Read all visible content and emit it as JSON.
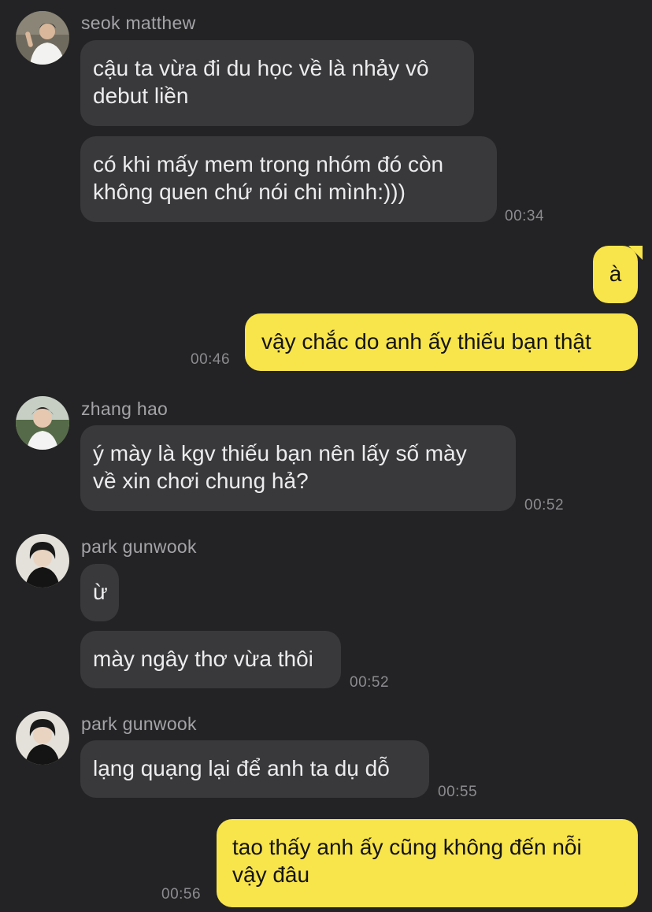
{
  "colors": {
    "background": "#232325",
    "incoming_bubble": "#39393b",
    "outgoing_bubble": "#f8e44b",
    "sender_text": "#a4a4a8",
    "time_text": "#8c8c90"
  },
  "messages": [
    {
      "sender": "seok matthew",
      "avatar_icon": "avatar-seok-matthew",
      "lines": [
        "cậu ta vừa đi du học về là nhảy vô",
        "debut liền"
      ]
    },
    {
      "lines": [
        "có khi mấy mem trong nhóm đó còn",
        "không quen chứ nói chi mình:)))"
      ],
      "time": "00:34"
    },
    {
      "outgoing": true,
      "lines": [
        "à"
      ]
    },
    {
      "outgoing": true,
      "lines": [
        "vậy chắc do anh ấy thiếu bạn thật"
      ],
      "time": "00:46"
    },
    {
      "sender": "zhang hao",
      "avatar_icon": "avatar-zhang-hao",
      "lines": [
        "ý mày là kgv thiếu bạn nên lấy số mày",
        "về xin chơi chung hả?"
      ],
      "time": "00:52"
    },
    {
      "sender": "park gunwook",
      "avatar_icon": "avatar-park-gunwook",
      "lines": [
        "ừ"
      ]
    },
    {
      "lines": [
        "mày ngây thơ vừa thôi"
      ],
      "time": "00:52"
    },
    {
      "sender": "park gunwook",
      "avatar_icon": "avatar-park-gunwook",
      "lines": [
        "lạng quạng lại để anh ta dụ dỗ"
      ],
      "time": "00:55"
    },
    {
      "outgoing": true,
      "lines": [
        "tao thấy anh ấy cũng không đến nỗi",
        "vậy đâu"
      ],
      "time": "00:56"
    }
  ]
}
